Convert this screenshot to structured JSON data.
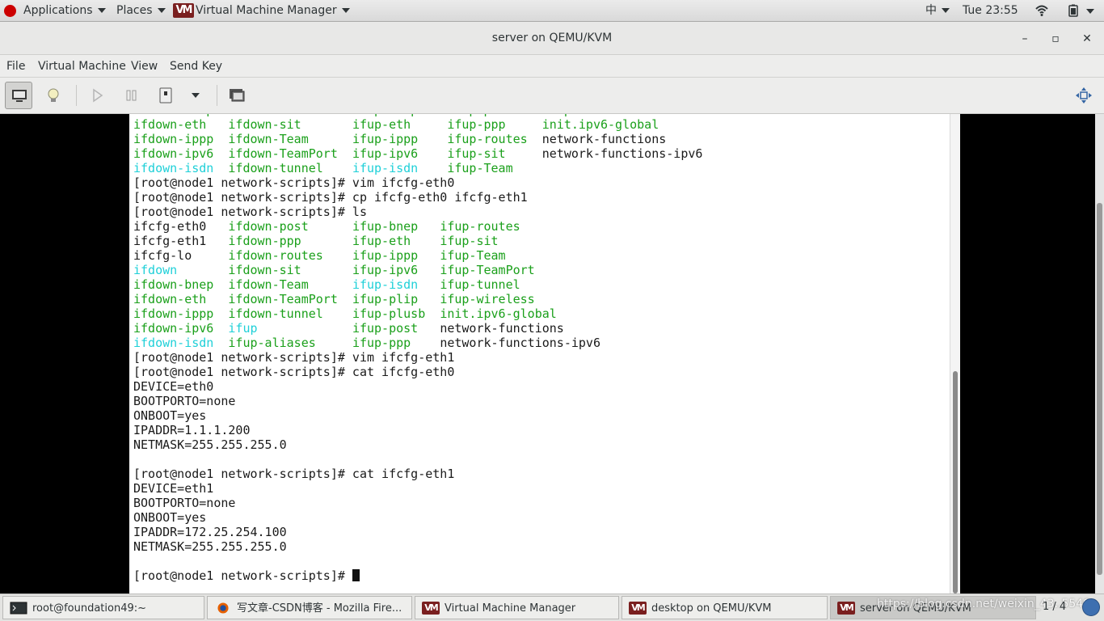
{
  "top_bar": {
    "applications": "Applications",
    "places": "Places",
    "app_menu": "Virtual Machine Manager",
    "input_method": "中",
    "clock": "Tue 23:55"
  },
  "window": {
    "title": "server on QEMU/KVM",
    "minimize": "–",
    "maximize": "▫",
    "close": "✕"
  },
  "menubar": {
    "file": "File",
    "virtual_machine": "Virtual Machine",
    "view": "View",
    "send_key": "Send Key"
  },
  "terminal": {
    "lines": [
      [
        {
          "t": "ifdown-bnep  ",
          "c": "g"
        },
        {
          "t": "ifdown-routes    ",
          "c": "g"
        },
        {
          "t": "ifup-bnep    ",
          "c": "g"
        },
        {
          "t": "ifup-post    ",
          "c": "g"
        },
        {
          "t": "ifup-wireless",
          "c": "g"
        }
      ],
      [
        {
          "t": "ifdown-eth   ",
          "c": "g"
        },
        {
          "t": "ifdown-sit       ",
          "c": "g"
        },
        {
          "t": "ifup-eth     ",
          "c": "g"
        },
        {
          "t": "ifup-ppp     ",
          "c": "g"
        },
        {
          "t": "init.ipv6-global",
          "c": "g"
        }
      ],
      [
        {
          "t": "ifdown-ippp  ",
          "c": "g"
        },
        {
          "t": "ifdown-Team      ",
          "c": "g"
        },
        {
          "t": "ifup-ippp    ",
          "c": "g"
        },
        {
          "t": "ifup-routes  ",
          "c": "g"
        },
        {
          "t": "network-functions",
          "c": ""
        }
      ],
      [
        {
          "t": "ifdown-ipv6  ",
          "c": "g"
        },
        {
          "t": "ifdown-TeamPort  ",
          "c": "g"
        },
        {
          "t": "ifup-ipv6    ",
          "c": "g"
        },
        {
          "t": "ifup-sit     ",
          "c": "g"
        },
        {
          "t": "network-functions-ipv6",
          "c": ""
        }
      ],
      [
        {
          "t": "ifdown-isdn  ",
          "c": "c"
        },
        {
          "t": "ifdown-tunnel    ",
          "c": "g"
        },
        {
          "t": "ifup-isdn    ",
          "c": "c"
        },
        {
          "t": "ifup-Team",
          "c": "g"
        }
      ],
      [
        {
          "t": "[root@node1 network-scripts]# vim ifcfg-eth0",
          "c": ""
        }
      ],
      [
        {
          "t": "[root@node1 network-scripts]# cp ifcfg-eth0 ifcfg-eth1",
          "c": ""
        }
      ],
      [
        {
          "t": "[root@node1 network-scripts]# ls",
          "c": ""
        }
      ],
      [
        {
          "t": "ifcfg-eth0   ",
          "c": ""
        },
        {
          "t": "ifdown-post      ",
          "c": "g"
        },
        {
          "t": "ifup-bnep   ",
          "c": "g"
        },
        {
          "t": "ifup-routes",
          "c": "g"
        }
      ],
      [
        {
          "t": "ifcfg-eth1   ",
          "c": ""
        },
        {
          "t": "ifdown-ppp       ",
          "c": "g"
        },
        {
          "t": "ifup-eth    ",
          "c": "g"
        },
        {
          "t": "ifup-sit",
          "c": "g"
        }
      ],
      [
        {
          "t": "ifcfg-lo     ",
          "c": ""
        },
        {
          "t": "ifdown-routes    ",
          "c": "g"
        },
        {
          "t": "ifup-ippp   ",
          "c": "g"
        },
        {
          "t": "ifup-Team",
          "c": "g"
        }
      ],
      [
        {
          "t": "ifdown       ",
          "c": "c"
        },
        {
          "t": "ifdown-sit       ",
          "c": "g"
        },
        {
          "t": "ifup-ipv6   ",
          "c": "g"
        },
        {
          "t": "ifup-TeamPort",
          "c": "g"
        }
      ],
      [
        {
          "t": "ifdown-bnep  ",
          "c": "g"
        },
        {
          "t": "ifdown-Team      ",
          "c": "g"
        },
        {
          "t": "ifup-isdn   ",
          "c": "c"
        },
        {
          "t": "ifup-tunnel",
          "c": "g"
        }
      ],
      [
        {
          "t": "ifdown-eth   ",
          "c": "g"
        },
        {
          "t": "ifdown-TeamPort  ",
          "c": "g"
        },
        {
          "t": "ifup-plip   ",
          "c": "g"
        },
        {
          "t": "ifup-wireless",
          "c": "g"
        }
      ],
      [
        {
          "t": "ifdown-ippp  ",
          "c": "g"
        },
        {
          "t": "ifdown-tunnel    ",
          "c": "g"
        },
        {
          "t": "ifup-plusb  ",
          "c": "g"
        },
        {
          "t": "init.ipv6-global",
          "c": "g"
        }
      ],
      [
        {
          "t": "ifdown-ipv6  ",
          "c": "g"
        },
        {
          "t": "ifup             ",
          "c": "c"
        },
        {
          "t": "ifup-post   ",
          "c": "g"
        },
        {
          "t": "network-functions",
          "c": ""
        }
      ],
      [
        {
          "t": "ifdown-isdn  ",
          "c": "c"
        },
        {
          "t": "ifup-aliases     ",
          "c": "g"
        },
        {
          "t": "ifup-ppp    ",
          "c": "g"
        },
        {
          "t": "network-functions-ipv6",
          "c": ""
        }
      ],
      [
        {
          "t": "[root@node1 network-scripts]# vim ifcfg-eth1",
          "c": ""
        }
      ],
      [
        {
          "t": "[root@node1 network-scripts]# cat ifcfg-eth0",
          "c": ""
        }
      ],
      [
        {
          "t": "DEVICE=eth0",
          "c": ""
        }
      ],
      [
        {
          "t": "BOOTPORTO=none",
          "c": ""
        }
      ],
      [
        {
          "t": "ONBOOT=yes",
          "c": ""
        }
      ],
      [
        {
          "t": "IPADDR=1.1.1.200",
          "c": ""
        }
      ],
      [
        {
          "t": "NETMASK=255.255.255.0",
          "c": ""
        }
      ],
      [
        {
          "t": "",
          "c": ""
        }
      ],
      [
        {
          "t": "[root@node1 network-scripts]# cat ifcfg-eth1",
          "c": ""
        }
      ],
      [
        {
          "t": "DEVICE=eth1",
          "c": ""
        }
      ],
      [
        {
          "t": "BOOTPORTO=none",
          "c": ""
        }
      ],
      [
        {
          "t": "ONBOOT=yes",
          "c": ""
        }
      ],
      [
        {
          "t": "IPADDR=172.25.254.100",
          "c": ""
        }
      ],
      [
        {
          "t": "NETMASK=255.255.255.0",
          "c": ""
        }
      ],
      [
        {
          "t": "",
          "c": ""
        }
      ]
    ],
    "prompt": "[root@node1 network-scripts]# "
  },
  "taskbar": {
    "tasks": [
      {
        "label": "root@foundation49:~",
        "icon": "terminal-icon"
      },
      {
        "label": "写文章-CSDN博客 - Mozilla Fire...",
        "icon": "firefox-icon"
      },
      {
        "label": "Virtual Machine Manager",
        "icon": "vm-manager-icon"
      },
      {
        "label": "desktop on QEMU/KVM",
        "icon": "vm-manager-icon"
      },
      {
        "label": "server on QEMU/KVM",
        "icon": "vm-manager-icon"
      }
    ],
    "watermark": "https://blog.csdn.net/weixin_43..5549",
    "pager": "1 / 4"
  },
  "colors": {
    "terminal_green": "#1ba01b",
    "terminal_cyan": "#1fd0d8"
  }
}
